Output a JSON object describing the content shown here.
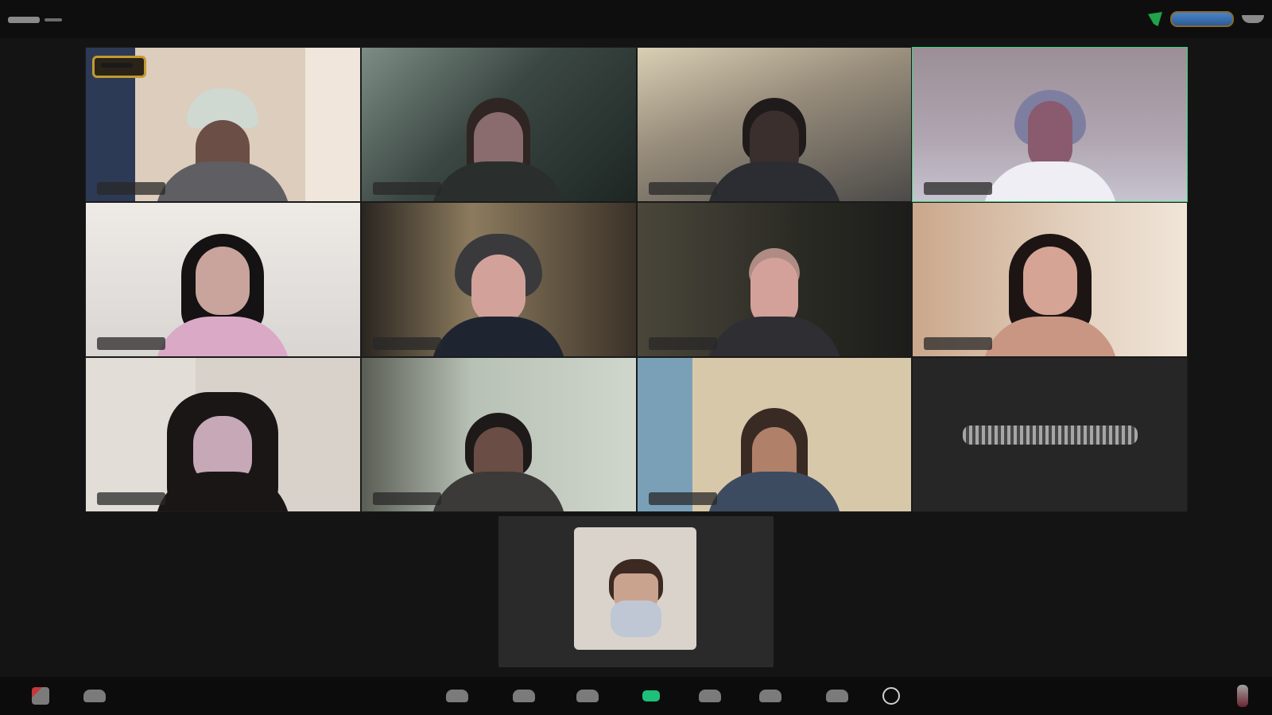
{
  "app": {
    "accent_active_speaker": "#3bd37a",
    "recording_badge_color": "#c29a2f",
    "share_color": "#1ec07a",
    "end_color": "#c73737"
  },
  "topbar": {
    "left_icon": "menu-icon",
    "security_icon": "shield-icon",
    "view_pill": "view-toggle",
    "fullscreen_icon": "fullscreen-icon"
  },
  "gallery": {
    "tiles": [
      {
        "id": 1,
        "active": false,
        "video_on": true,
        "recording_badge": true
      },
      {
        "id": 2,
        "active": false,
        "video_on": true
      },
      {
        "id": 3,
        "active": false,
        "video_on": true
      },
      {
        "id": 4,
        "active": true,
        "video_on": true
      },
      {
        "id": 5,
        "active": false,
        "video_on": true
      },
      {
        "id": 6,
        "active": false,
        "video_on": true
      },
      {
        "id": 7,
        "active": false,
        "video_on": true
      },
      {
        "id": 8,
        "active": false,
        "video_on": true
      },
      {
        "id": 9,
        "active": false,
        "video_on": true
      },
      {
        "id": 10,
        "active": false,
        "video_on": true
      },
      {
        "id": 11,
        "active": false,
        "video_on": true
      },
      {
        "id": 12,
        "active": false,
        "video_on": false
      }
    ]
  },
  "self_view": {
    "video_on": true
  },
  "toolbar": {
    "buttons": [
      {
        "icon": "microphone-muted-icon"
      },
      {
        "icon": "video-camera-icon"
      },
      {
        "icon": "security-icon"
      },
      {
        "icon": "participants-icon"
      },
      {
        "icon": "chat-icon"
      },
      {
        "icon": "share-screen-icon"
      },
      {
        "icon": "record-icon"
      },
      {
        "icon": "reactions-icon"
      },
      {
        "icon": "apps-icon"
      },
      {
        "icon": "settings-icon"
      },
      {
        "icon": "end-call-icon"
      }
    ]
  }
}
